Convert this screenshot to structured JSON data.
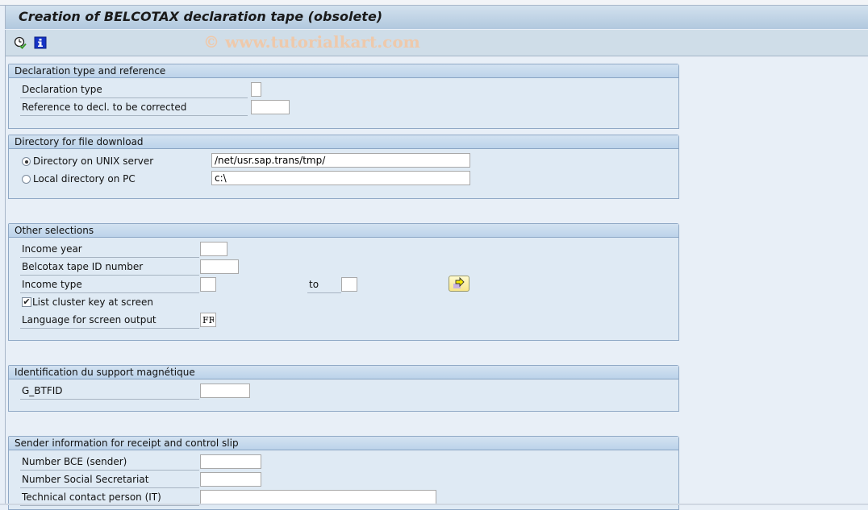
{
  "window": {
    "title": "Creation of BELCOTAX declaration tape (obsolete)",
    "watermark": "© www.tutorialkart.com"
  },
  "toolbar": {
    "icons": [
      {
        "name": "execute-in-background-icon",
        "glyph": "clock-check"
      },
      {
        "name": "program-documentation-icon",
        "glyph": "i"
      }
    ]
  },
  "groups": {
    "declaration": {
      "title": "Declaration type and reference",
      "fields": {
        "declaration_type": {
          "label": "Declaration type",
          "value": ""
        },
        "reference": {
          "label": "Reference to decl. to be corrected",
          "value": ""
        }
      }
    },
    "directory": {
      "title": "Directory for file download",
      "unix": {
        "label": "Directory on UNIX server",
        "value": "/net/usr.sap.trans/tmp/",
        "selected": true
      },
      "local": {
        "label": "Local directory on PC",
        "value": "c:\\",
        "selected": false
      }
    },
    "other": {
      "title": "Other selections",
      "income_year": {
        "label": "Income year",
        "value": ""
      },
      "tape_id": {
        "label": "Belcotax tape ID number",
        "value": ""
      },
      "income_type": {
        "label": "Income type",
        "from": "",
        "to_label": "to",
        "to": ""
      },
      "list_cluster": {
        "label": "List cluster key at screen",
        "checked": true,
        "check_glyph": "✔"
      },
      "language": {
        "label": "Language for screen output",
        "value": "FR"
      }
    },
    "identification": {
      "title": "Identification du support magnétique",
      "g_btfid": {
        "label": "G_BTFID",
        "value": ""
      }
    },
    "sender": {
      "title": "Sender information for receipt and control slip",
      "bce": {
        "label": "Number BCE (sender)",
        "value": ""
      },
      "social_secretariat": {
        "label": "Number Social Secretariat",
        "value": ""
      },
      "technical_contact": {
        "label": "Technical contact person (IT)",
        "value": ""
      }
    }
  }
}
